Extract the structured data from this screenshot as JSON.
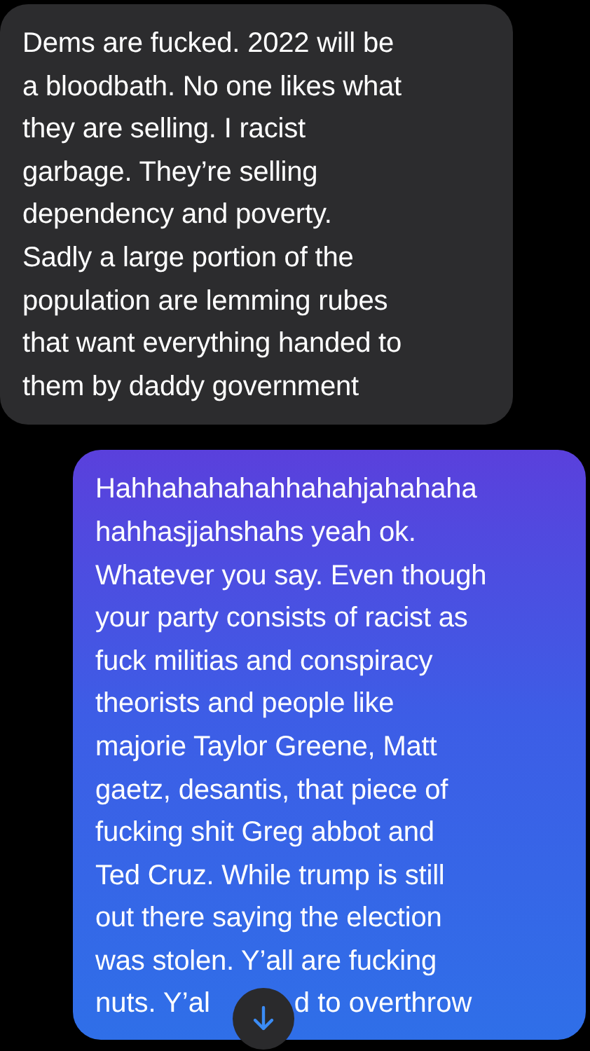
{
  "messages": [
    {
      "kind": "received",
      "lines": [
        "Dems are fucked. 2022 will be",
        "a bloodbath. No one likes what",
        "they are selling. I racist",
        "garbage. They’re selling",
        "dependency and poverty.",
        "Sadly a large portion of the",
        "population are lemming rubes",
        "that want everything handed to",
        "them by daddy government"
      ]
    },
    {
      "kind": "sent",
      "lines": [
        "Hahhahahahahhahahjahahaha",
        "hahhasjjahshahs yeah ok.",
        "Whatever you say. Even though",
        "your party consists of racist as",
        "fuck militias and conspiracy",
        "theorists and people like",
        "majorie Taylor Greene, Matt",
        "gaetz, desantis, that piece of",
        "fucking shit Greg abbot and",
        "Ted Cruz. While trump is still",
        "out there saying the election",
        "was stolen. Y’all are fucking"
      ],
      "covered_lines": [
        {
          "left": "nuts. Y’al",
          "right": "d to overthrow"
        }
      ]
    }
  ]
}
